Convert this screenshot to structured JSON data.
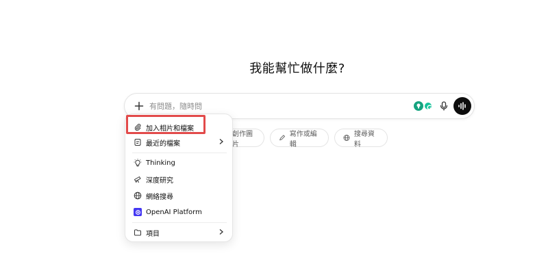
{
  "headline": "我能幫忙做什麼?",
  "composer": {
    "placeholder": "有問題，隨時問",
    "value": ""
  },
  "chips": {
    "image_label": "創作圖片",
    "write_label": "寫作或編輯",
    "search_label": "搜尋資料"
  },
  "menu": {
    "items": [
      {
        "label": "加入相片和檔案",
        "icon": "paperclip-icon"
      },
      {
        "label": "最近的檔案",
        "icon": "document-icon",
        "submenu": true
      },
      {
        "label": "Thinking",
        "icon": "lightbulb-icon"
      },
      {
        "label": "深度研究",
        "icon": "telescope-icon"
      },
      {
        "label": "網絡搜尋",
        "icon": "globe-icon"
      },
      {
        "label": "OpenAI Platform",
        "icon": "openai-icon"
      },
      {
        "label": "項目",
        "icon": "folder-icon",
        "submenu": true
      }
    ]
  },
  "colors": {
    "highlight": "#e24a4a",
    "voice_button": "#0d0d0d",
    "openai_icon_bg": "#4437f2",
    "extension_green": "#15a37f"
  }
}
